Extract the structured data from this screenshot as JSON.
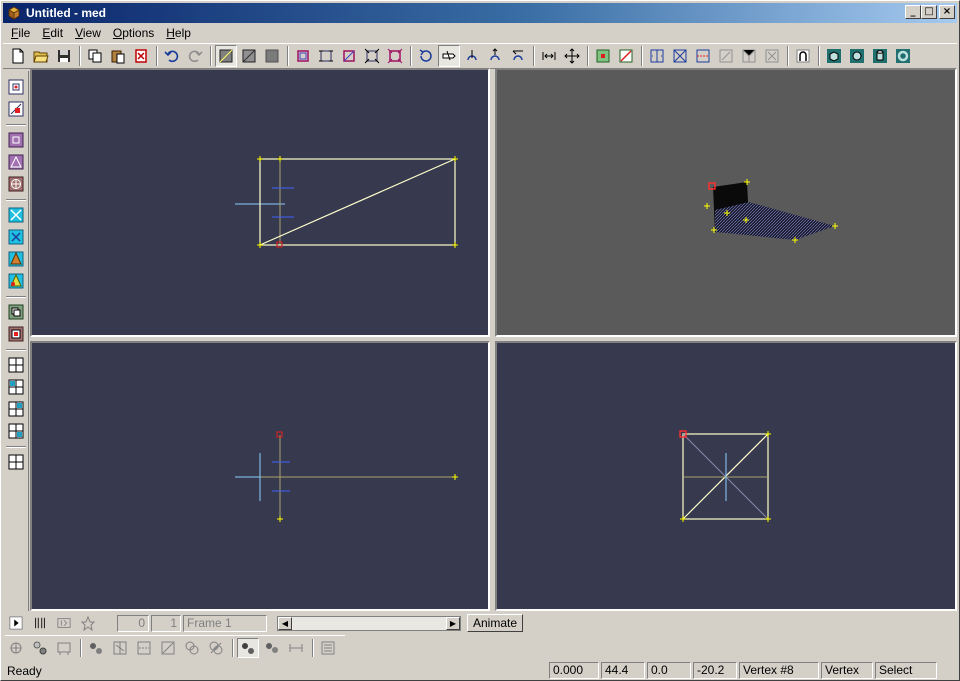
{
  "window": {
    "title": "Untitled - med",
    "minimize": "_",
    "maximize": "□",
    "close": "×"
  },
  "menu": [
    {
      "mnemonic": "F",
      "rest": "ile"
    },
    {
      "mnemonic": "E",
      "rest": "dit"
    },
    {
      "mnemonic": "V",
      "rest": "iew"
    },
    {
      "mnemonic": "O",
      "rest": "ptions"
    },
    {
      "mnemonic": "H",
      "rest": "elp"
    }
  ],
  "animation": {
    "start_frame": "0",
    "end_frame": "1",
    "frame_label": "Frame 1",
    "animate_label": "Animate"
  },
  "status": {
    "ready": "Ready",
    "x": "0.000",
    "y": "44.4",
    "z": "0.0",
    "w": "-20.2",
    "selection": "Vertex #8",
    "mode": "Vertex",
    "tool": "Select"
  },
  "colors": {
    "viewport_bg": "#373a4e",
    "perspective_bg": "#5a5a5a",
    "wire": "#ffffcc",
    "vertex": "#ffff00",
    "selected_vertex": "#cc2222",
    "axis": "#a8a36a",
    "normal": "#88ccff"
  }
}
